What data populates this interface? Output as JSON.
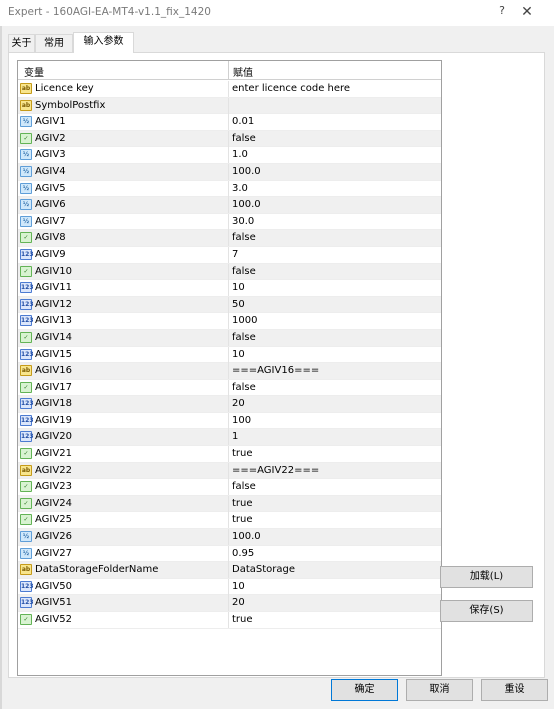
{
  "window": {
    "title": "Expert - 160AGI-EA-MT4-v1.1_fix_1420",
    "help_glyph": "?",
    "close_glyph": "✕"
  },
  "tabs": [
    {
      "label": "关于",
      "active": false
    },
    {
      "label": "常用",
      "active": false
    },
    {
      "label": "输入参数",
      "active": true
    }
  ],
  "grid": {
    "col_variable": "变量",
    "col_value": "赋值",
    "rows": [
      {
        "type": "str",
        "name": "Licence key",
        "value": "enter licence code here"
      },
      {
        "type": "str",
        "name": "SymbolPostfix",
        "value": ""
      },
      {
        "type": "dbl",
        "name": "AGIV1",
        "value": "0.01"
      },
      {
        "type": "bool",
        "name": "AGIV2",
        "value": "false"
      },
      {
        "type": "dbl",
        "name": "AGIV3",
        "value": "1.0"
      },
      {
        "type": "dbl",
        "name": "AGIV4",
        "value": "100.0"
      },
      {
        "type": "dbl",
        "name": "AGIV5",
        "value": "3.0"
      },
      {
        "type": "dbl",
        "name": "AGIV6",
        "value": "100.0"
      },
      {
        "type": "dbl",
        "name": "AGIV7",
        "value": "30.0"
      },
      {
        "type": "bool",
        "name": "AGIV8",
        "value": "false"
      },
      {
        "type": "int",
        "name": "AGIV9",
        "value": "7"
      },
      {
        "type": "bool",
        "name": "AGIV10",
        "value": "false"
      },
      {
        "type": "int",
        "name": "AGIV11",
        "value": "10"
      },
      {
        "type": "int",
        "name": "AGIV12",
        "value": "50"
      },
      {
        "type": "int",
        "name": "AGIV13",
        "value": "1000"
      },
      {
        "type": "bool",
        "name": "AGIV14",
        "value": "false"
      },
      {
        "type": "int",
        "name": "AGIV15",
        "value": "10"
      },
      {
        "type": "str",
        "name": "AGIV16",
        "value": "===AGIV16==="
      },
      {
        "type": "bool",
        "name": "AGIV17",
        "value": "false"
      },
      {
        "type": "int",
        "name": "AGIV18",
        "value": "20"
      },
      {
        "type": "int",
        "name": "AGIV19",
        "value": "100"
      },
      {
        "type": "int",
        "name": "AGIV20",
        "value": "1"
      },
      {
        "type": "bool",
        "name": "AGIV21",
        "value": "true"
      },
      {
        "type": "str",
        "name": "AGIV22",
        "value": "===AGIV22==="
      },
      {
        "type": "bool",
        "name": "AGIV23",
        "value": "false"
      },
      {
        "type": "bool",
        "name": "AGIV24",
        "value": "true"
      },
      {
        "type": "bool",
        "name": "AGIV25",
        "value": "true"
      },
      {
        "type": "dbl",
        "name": "AGIV26",
        "value": "100.0"
      },
      {
        "type": "dbl",
        "name": "AGIV27",
        "value": "0.95"
      },
      {
        "type": "str",
        "name": "DataStorageFolderName",
        "value": "DataStorage"
      },
      {
        "type": "int",
        "name": "AGIV50",
        "value": "10"
      },
      {
        "type": "int",
        "name": "AGIV51",
        "value": "20"
      },
      {
        "type": "bool",
        "name": "AGIV52",
        "value": "true"
      }
    ]
  },
  "type_icons": {
    "str": {
      "icon": "string-type-icon",
      "glyph": "ab"
    },
    "dbl": {
      "icon": "double-type-icon",
      "glyph": "½"
    },
    "bool": {
      "icon": "bool-type-icon",
      "glyph": "✓"
    },
    "int": {
      "icon": "int-type-icon",
      "glyph": "123"
    }
  },
  "buttons": {
    "load": "加载(L)",
    "save": "保存(S)",
    "ok": "确定",
    "cancel": "取消",
    "reset": "重设"
  },
  "colors": {
    "accent": "#0078d7",
    "row_alt": "#f0f0f0",
    "panel_bg": "#f0f0f0"
  }
}
